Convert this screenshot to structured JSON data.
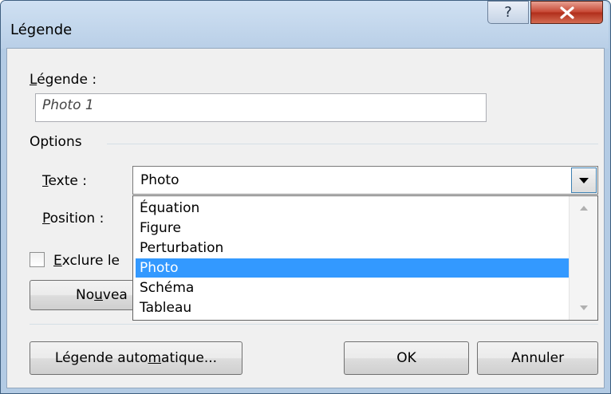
{
  "window": {
    "title": "Légende",
    "help_glyph": "?",
    "close_glyph": "✕"
  },
  "caption": {
    "label_mnemonic": "L",
    "label_rest": "égende :",
    "value": "Photo 1"
  },
  "options": {
    "group_label": "Options",
    "text_label_mnemonic": "T",
    "text_label_rest": "exte :",
    "text_selected": "Photo",
    "position_label_mnemonic": "P",
    "position_label_rest": "osition :",
    "exclude_label_prefix": "",
    "exclude_label_mnemonic": "E",
    "exclude_label_rest": "xclure le",
    "label_list": [
      "Équation",
      "Figure",
      "Perturbation",
      "Photo",
      "Schéma",
      "Tableau"
    ],
    "highlighted_item": "Photo"
  },
  "buttons": {
    "new_label_pre": "No",
    "new_label_mnemonic": "u",
    "new_label_rest": "vea",
    "autocaption_pre": "Légende auto",
    "autocaption_mnemonic": "m",
    "autocaption_rest": "atique...",
    "ok": "OK",
    "cancel": "Annuler"
  },
  "colors": {
    "selection": "#3399ff",
    "close_button": "#c64532",
    "dialog_bg": "#f0f0f0"
  }
}
